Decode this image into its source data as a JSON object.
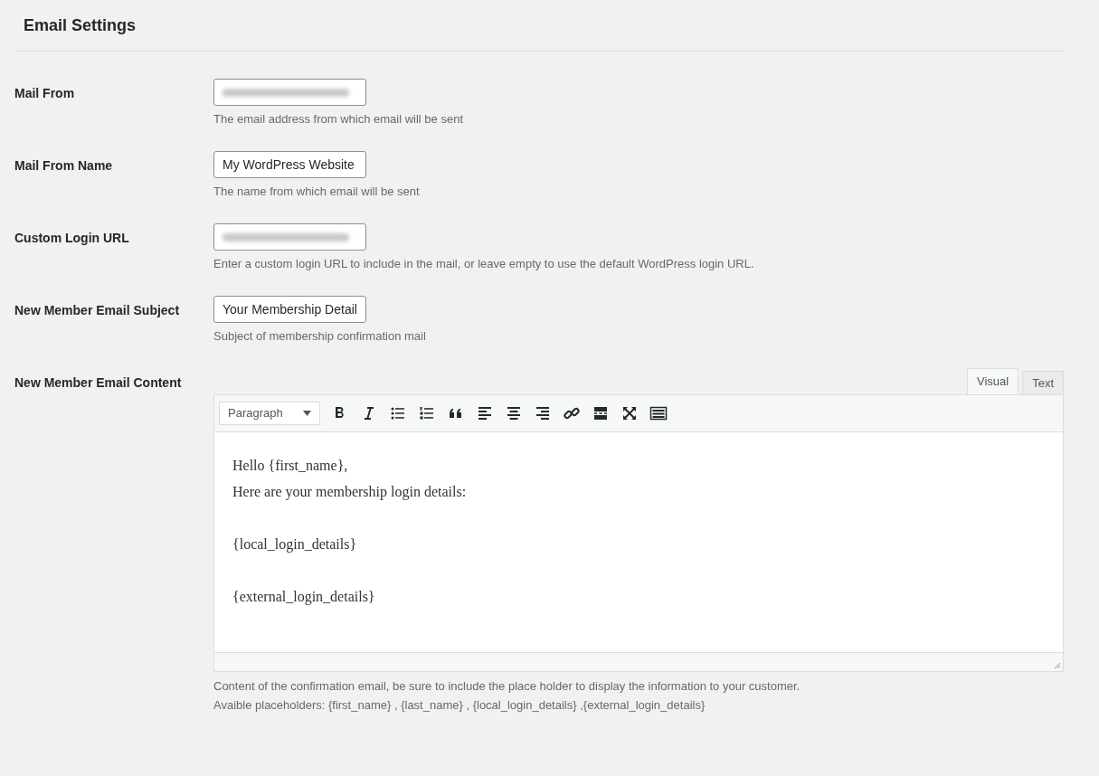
{
  "title": "Email Settings",
  "fields": [
    {
      "label": "Mail From",
      "redacted": true,
      "description": "The email address from which email will be sent"
    },
    {
      "label": "Mail From Name",
      "redacted": false,
      "value": "My WordPress Website",
      "description": "The name from which email will be sent"
    },
    {
      "label": "Custom Login URL",
      "redacted": true,
      "description": "Enter a custom login URL to include in the mail, or leave empty to use the default WordPress login URL."
    },
    {
      "label": "New Member Email Subject",
      "redacted": false,
      "value": "Your Membership Detail",
      "description": "Subject of membership confirmation mail"
    }
  ],
  "editor": {
    "label": "New Member Email Content",
    "tabs": [
      {
        "label": "Visual",
        "selected": true
      },
      {
        "label": "Text",
        "selected": false
      }
    ],
    "format": "Paragraph",
    "tools": [
      {
        "kind": "bold"
      },
      {
        "kind": "italic"
      },
      {
        "kind": "bullet-list"
      },
      {
        "kind": "numbered-list"
      },
      {
        "kind": "quote"
      },
      {
        "kind": "align-left"
      },
      {
        "kind": "align-center"
      },
      {
        "kind": "align-right"
      },
      {
        "kind": "link"
      },
      {
        "kind": "read-more"
      },
      {
        "kind": "fullscreen"
      },
      {
        "kind": "keyboard"
      }
    ],
    "blocks": [
      [
        "Hello {first_name},",
        "Here are your membership login details:"
      ],
      [
        "{local_login_details}"
      ],
      [
        "{external_login_details}"
      ]
    ],
    "notes": [
      "Content of the confirmation email, be sure to include the place holder to display the information to your customer.",
      "Avaible placeholders: {first_name} , {last_name} , {local_login_details} ,{external_login_details}"
    ]
  }
}
